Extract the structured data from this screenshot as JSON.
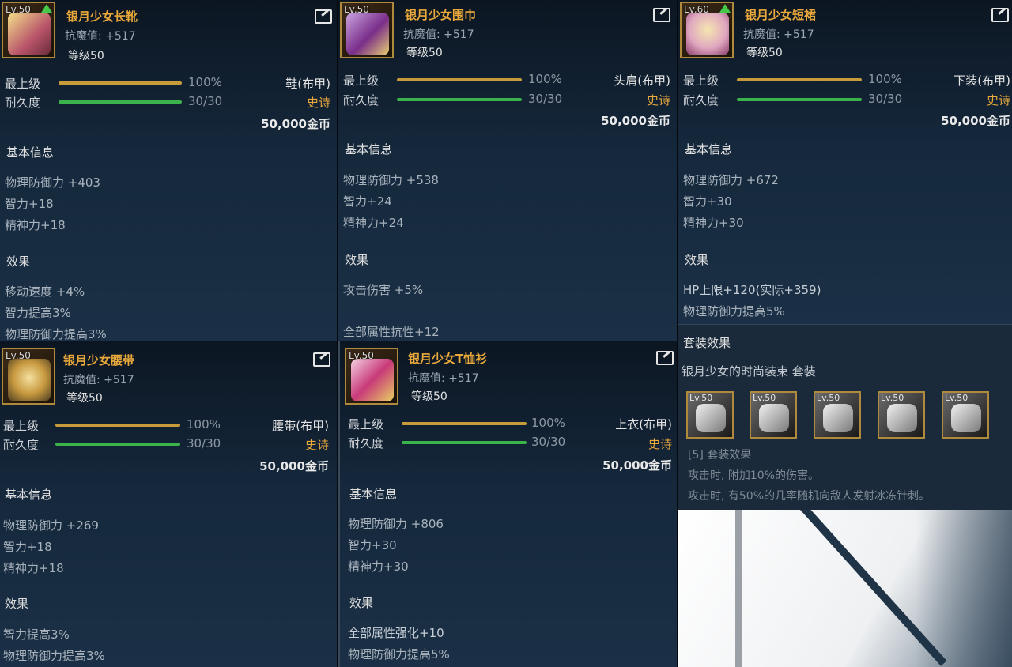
{
  "labels": {
    "max_level": "最上级",
    "durability": "耐久度",
    "basic_info": "基本信息",
    "effects": "效果",
    "level_prefix": "等级50"
  },
  "panels": [
    {
      "id": "boots",
      "lv": "Lv.50",
      "up": true,
      "name": "银月少女长靴",
      "resist": "抗魔值: +517",
      "level": "等级50",
      "max_val": "100%",
      "dur_val": "30/30",
      "slot": "鞋(布甲)",
      "rarity": "史诗",
      "price": "50,000金币",
      "stats": [
        "物理防御力 +403",
        "智力+18",
        "精神力+18"
      ],
      "effects": [
        "移动速度 +4%",
        "智力提高3%",
        "物理防御力提高3%"
      ]
    },
    {
      "id": "scarf",
      "lv": "Lv.50",
      "up": false,
      "name": "银月少女围巾",
      "resist": "抗魔值: +517",
      "level": "等级50",
      "max_val": "100%",
      "dur_val": "30/30",
      "slot": "头肩(布甲)",
      "rarity": "史诗",
      "price": "50,000金币",
      "stats": [
        "物理防御力 +538",
        "智力+24",
        "精神力+24"
      ],
      "effects": [
        "攻击伤害 +5%",
        "全部属性抗性+12"
      ]
    },
    {
      "id": "skirt",
      "lv": "Lv.60",
      "up": true,
      "name": "银月少女短裙",
      "resist": "抗魔值: +517",
      "level": "等级50",
      "max_val": "100%",
      "dur_val": "30/30",
      "slot": "下装(布甲)",
      "rarity": "史诗",
      "price": "50,000金币",
      "stats": [
        "物理防御力 +672",
        "智力+30",
        "精神力+30"
      ],
      "effects": [
        "HP上限+120(实际+359)",
        "物理防御力提高5%"
      ]
    },
    {
      "id": "belt",
      "lv": "Lv.50",
      "up": false,
      "name": "银月少女腰带",
      "resist": "抗魔值: +517",
      "level": "等级50",
      "max_val": "100%",
      "dur_val": "30/30",
      "slot": "腰带(布甲)",
      "rarity": "史诗",
      "price": "50,000金币",
      "stats": [
        "物理防御力 +269",
        "智力+18",
        "精神力+18"
      ],
      "effects": [
        "智力提高3%",
        "物理防御力提高3%"
      ]
    },
    {
      "id": "tshirt",
      "lv": "Lv.50",
      "up": false,
      "name": "银月少女T恤衫",
      "resist": "抗魔值: +517",
      "level": "等级50",
      "max_val": "100%",
      "dur_val": "30/30",
      "slot": "上衣(布甲)",
      "rarity": "史诗",
      "price": "50,000金币",
      "stats": [
        "物理防御力 +806",
        "智力+30",
        "精神力+30"
      ],
      "effects": [
        "全部属性强化+10",
        "物理防御力提高5%"
      ]
    }
  ],
  "set": {
    "title": "套装效果",
    "name": "银月少女的时尚装束 套装",
    "icons": [
      "Lv.50",
      "Lv.50",
      "Lv.50",
      "Lv.50",
      "Lv.50"
    ],
    "tier": "[5] 套装效果",
    "lines": [
      "攻击时, 附加10%的伤害。",
      "攻击时, 有50%的几率随机向敌人发射冰冻针刺。"
    ]
  },
  "colors": {
    "name_gold": "#e9a93b",
    "gold_bar": "#c79a3a",
    "green_bar": "#39b34a",
    "icon_border": "#b08a3c"
  }
}
